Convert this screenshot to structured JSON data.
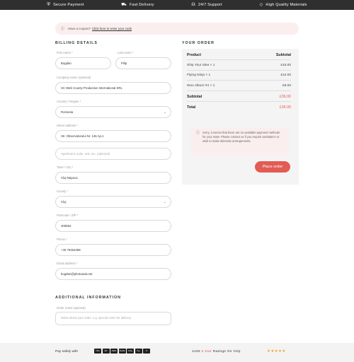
{
  "topbar": [
    {
      "icon": "shield-icon",
      "glyph": "⛨",
      "label": "Secure Payment"
    },
    {
      "icon": "truck-icon",
      "glyph": "⛟",
      "label": "Fast Delivery"
    },
    {
      "icon": "headset-icon",
      "glyph": "☊",
      "label": "24/7 Support"
    },
    {
      "icon": "diamond-icon",
      "glyph": "◇",
      "label": "High Quality Materials"
    }
  ],
  "coupon": {
    "icon": "ⓘ",
    "text": "Have a coupon?",
    "link": "Click here to enter your code"
  },
  "billing": {
    "title": "BILLING DETAILS",
    "first_name": {
      "label": "First name *",
      "value": "Bogdan"
    },
    "last_name": {
      "label": "Last name *",
      "value": "Pilip"
    },
    "company": {
      "label": "Company name (optional)",
      "value": "SC Web County Production International SRL"
    },
    "country": {
      "label": "Country / Region *",
      "value": "Romania"
    },
    "street": {
      "label": "Street address *",
      "value": "Str. Observatorului Nr. 146 Ap.1",
      "placeholder2": "Apartment, suite, unit, etc. (optional)"
    },
    "city": {
      "label": "Town / City *",
      "value": "Cluj-Napoca"
    },
    "county": {
      "label": "County *",
      "value": "Cluj"
    },
    "postcode": {
      "label": "Postcode / ZIP *",
      "value": "400592"
    },
    "phone": {
      "label": "Phone *",
      "value": "+40 76454488"
    },
    "email": {
      "label": "Email address *",
      "value": "bogdan@photoavia.net"
    }
  },
  "additional": {
    "title": "ADDITIONAL INFORMATION",
    "notes_label": "Order notes (optional)",
    "notes_placeholder": "Notes about your order, e.g. special notes for delivery."
  },
  "order": {
    "title": "YOUR ORDER",
    "col_product": "Product",
    "col_subtotal": "Subtotal",
    "items": [
      {
        "name": "Ship Your Idea",
        "qty": "× 1",
        "price": "£15.00"
      },
      {
        "name": "Flying Ninja",
        "qty": "× 1",
        "price": "£12.00"
      },
      {
        "name": "Woo Album #4",
        "qty": "× 1",
        "price": "£9.00"
      }
    ],
    "subtotal_label": "Subtotal",
    "subtotal_value": "£36.00",
    "total_label": "Total",
    "total_value": "£36.00",
    "notice": "Sorry, it seems that there are no available payment methods for your state. Please contact us if you require assistance or wish to make alternate arrangements.",
    "place_order": "Place order"
  },
  "footer": {
    "pay_text": "Pay safely with",
    "cards": [
      "VISA",
      "MC",
      "AMEX",
      "PayPal",
      "GPay",
      "Pay",
      "B"
    ],
    "ratings_count": "1245",
    "ratings_star": "5 Star",
    "ratings_rest": "Ratings On Yelp",
    "stars": "★★★★★"
  }
}
